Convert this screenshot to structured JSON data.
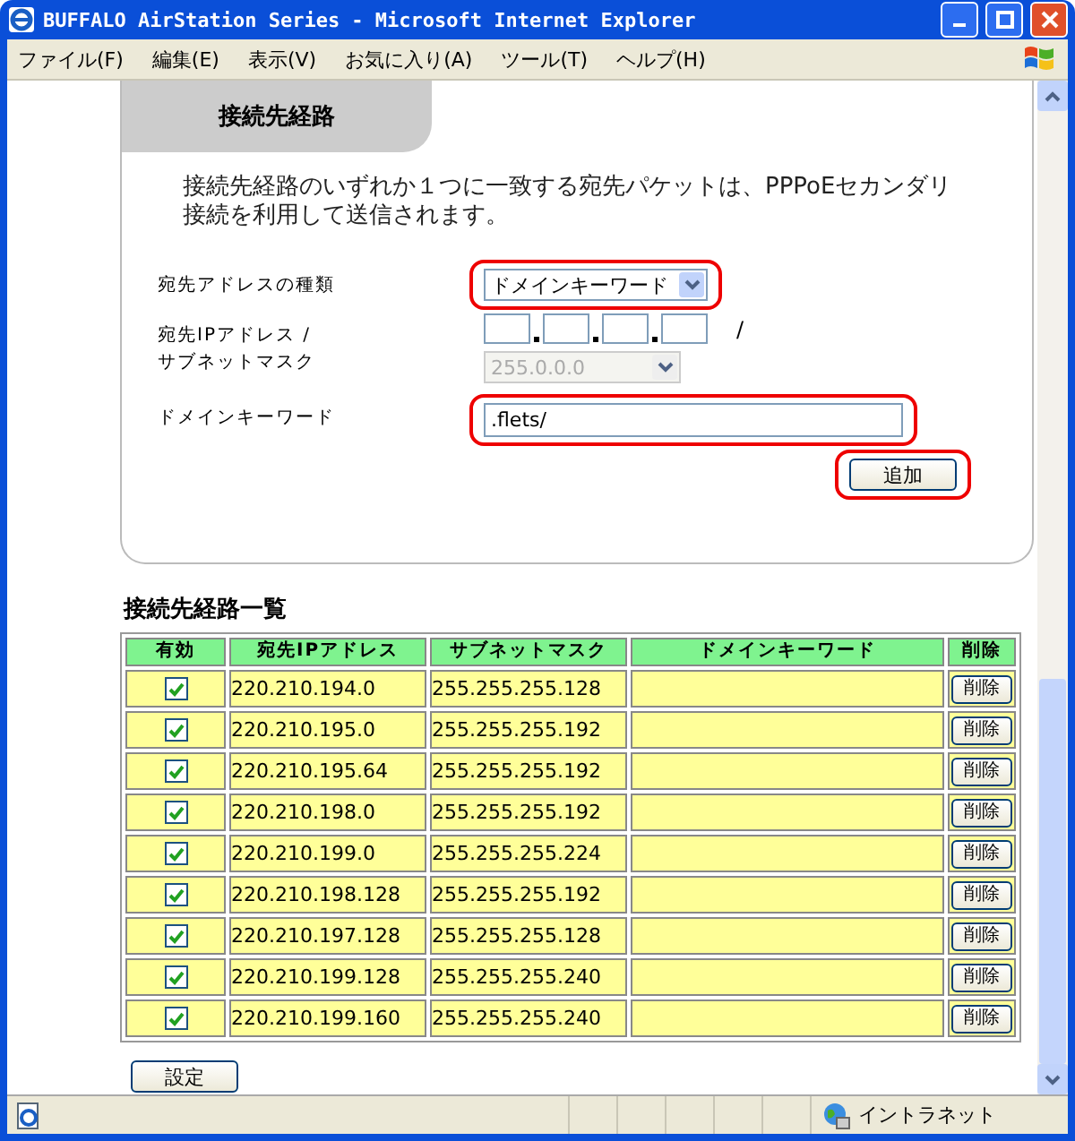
{
  "window": {
    "title": "BUFFALO AirStation Series - Microsoft Internet Explorer"
  },
  "menu": [
    "ファイル(F)",
    "編集(E)",
    "表示(V)",
    "お気に入り(A)",
    "ツール(T)",
    "ヘルプ(H)"
  ],
  "panel": {
    "tab": "接続先経路",
    "description": "接続先経路のいずれか１つに一致する宛先パケットは、PPPoEセカンダリ接続を利用して送信されます。",
    "type_label": "宛先アドレスの種類",
    "type_value": "ドメインキーワード",
    "type_highlighted": true,
    "ip_label": "宛先IPアドレス /",
    "mask_label": "サブネットマスク",
    "ip_separator": "/",
    "mask_value": "255.0.0.0",
    "mask_disabled": true,
    "domain_label": "ドメインキーワード",
    "domain_value": ".flets/",
    "domain_highlighted": true,
    "add_button": "追加",
    "add_highlighted": true
  },
  "list": {
    "title": "接続先経路一覧",
    "columns": [
      "有効",
      "宛先IPアドレス",
      "サブネットマスク",
      "ドメインキーワード",
      "削除"
    ],
    "rows": [
      {
        "enabled": true,
        "ip": "220.210.194.0",
        "mask": "255.255.255.128",
        "delete": "削除"
      },
      {
        "enabled": true,
        "ip": "220.210.195.0",
        "mask": "255.255.255.192",
        "delete": "削除"
      },
      {
        "enabled": true,
        "ip": "220.210.195.64",
        "mask": "255.255.255.192",
        "delete": "削除"
      },
      {
        "enabled": true,
        "ip": "220.210.198.0",
        "mask": "255.255.255.192",
        "delete": "削除"
      },
      {
        "enabled": true,
        "ip": "220.210.199.0",
        "mask": "255.255.255.224",
        "delete": "削除"
      },
      {
        "enabled": true,
        "ip": "220.210.198.128",
        "mask": "255.255.255.192",
        "delete": "削除"
      },
      {
        "enabled": true,
        "ip": "220.210.197.128",
        "mask": "255.255.255.128",
        "delete": "削除"
      },
      {
        "enabled": true,
        "ip": "220.210.199.128",
        "mask": "255.255.255.240",
        "delete": "削除"
      },
      {
        "enabled": true,
        "ip": "220.210.199.160",
        "mask": "255.255.255.240",
        "delete": "削除"
      }
    ]
  },
  "save_button": "設定",
  "status_bar": {
    "zone": "イントラネット"
  }
}
